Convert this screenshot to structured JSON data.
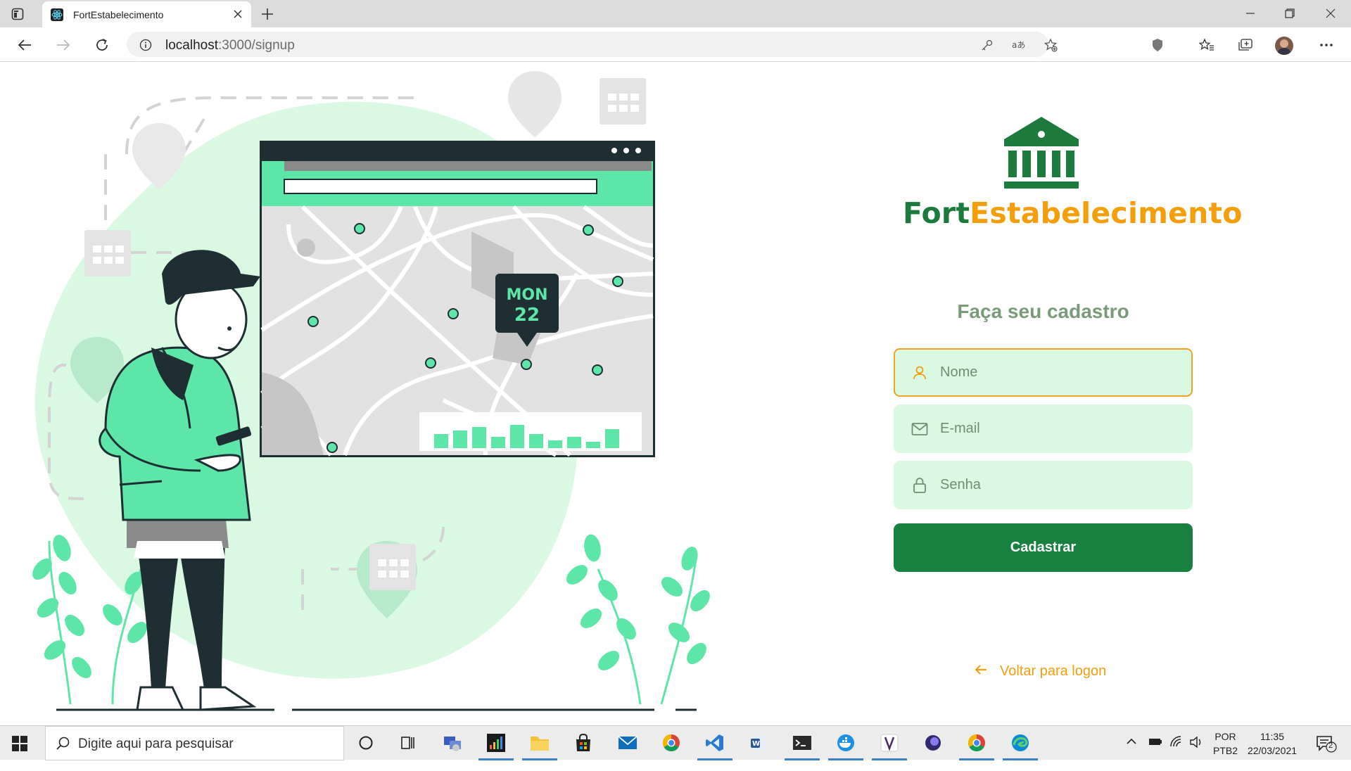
{
  "browser": {
    "tab_title": "FortEstabelecimento",
    "url_host": "localhost",
    "url_path": ":3000/signup"
  },
  "page": {
    "brand_part1": "Fort",
    "brand_part2": "Estabelecimento",
    "form_title": "Faça seu cadastro",
    "fields": {
      "name_placeholder": "Nome",
      "email_placeholder": "E-mail",
      "password_placeholder": "Senha"
    },
    "submit_label": "Cadastrar",
    "back_link_label": "Voltar para logon",
    "illustration": {
      "pin_day": "MON",
      "pin_date": "22"
    },
    "colors": {
      "brand_green": "#1b7a3c",
      "brand_orange": "#f59e0b",
      "input_bg": "#d9f9e3",
      "button_bg": "#18813f",
      "accent_mint": "#5ee6a8"
    }
  },
  "taskbar": {
    "search_placeholder": "Digite aqui para pesquisar",
    "lang_top": "POR",
    "lang_bottom": "PTB2",
    "time": "11:35",
    "date": "22/03/2021",
    "notification_count": "2"
  }
}
